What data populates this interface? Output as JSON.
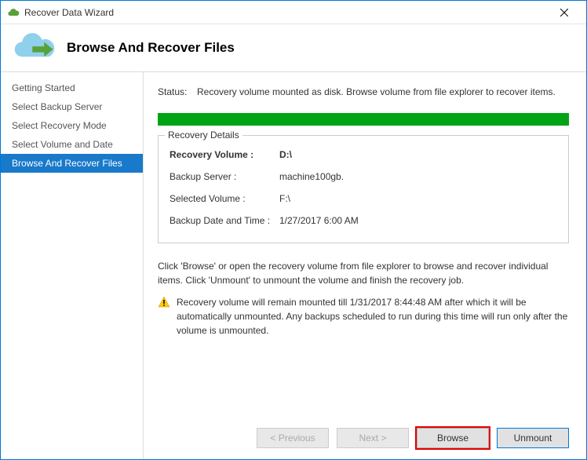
{
  "window": {
    "title": "Recover Data Wizard"
  },
  "header": {
    "page_title": "Browse And Recover Files"
  },
  "sidebar": {
    "items": [
      {
        "label": "Getting Started"
      },
      {
        "label": "Select Backup Server"
      },
      {
        "label": "Select Recovery Mode"
      },
      {
        "label": "Select Volume and Date"
      },
      {
        "label": "Browse And Recover Files"
      }
    ],
    "active_index": 4
  },
  "status": {
    "label": "Status:",
    "text": "Recovery volume mounted as disk. Browse volume from file explorer to recover items."
  },
  "recovery_details": {
    "legend": "Recovery Details",
    "rows": [
      {
        "k": "Recovery Volume :",
        "v": "D:\\",
        "bold": true
      },
      {
        "k": "Backup Server :",
        "v": "machine100gb."
      },
      {
        "k": "Selected Volume :",
        "v": "F:\\"
      },
      {
        "k": "Backup Date and Time :",
        "v": "1/27/2017 6:00 AM"
      }
    ]
  },
  "instruction_text": "Click 'Browse' or open the recovery volume from file explorer to browse and recover individual items. Click 'Unmount' to unmount the volume and finish the recovery job.",
  "warning_text": "Recovery volume will remain mounted till 1/31/2017 8:44:48 AM after which it will be automatically unmounted. Any backups scheduled to run during this time will run only after the volume is unmounted.",
  "footer": {
    "previous": "< Previous",
    "next": "Next >",
    "browse": "Browse",
    "unmount": "Unmount"
  },
  "colors": {
    "progress": "#00a415",
    "sidebar_active": "#1979ca"
  }
}
